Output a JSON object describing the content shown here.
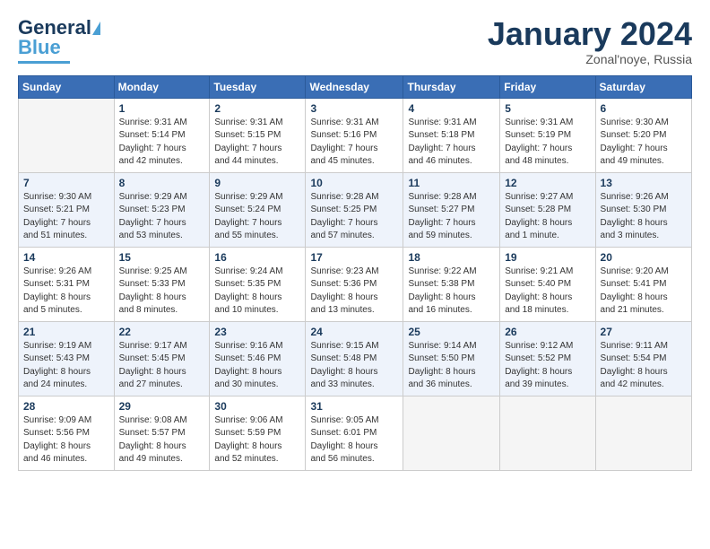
{
  "header": {
    "logo_line1": "General",
    "logo_line2": "Blue",
    "month": "January 2024",
    "location": "Zonal'noye, Russia"
  },
  "days_of_week": [
    "Sunday",
    "Monday",
    "Tuesday",
    "Wednesday",
    "Thursday",
    "Friday",
    "Saturday"
  ],
  "weeks": [
    [
      {
        "day": "",
        "info": ""
      },
      {
        "day": "1",
        "info": "Sunrise: 9:31 AM\nSunset: 5:14 PM\nDaylight: 7 hours\nand 42 minutes."
      },
      {
        "day": "2",
        "info": "Sunrise: 9:31 AM\nSunset: 5:15 PM\nDaylight: 7 hours\nand 44 minutes."
      },
      {
        "day": "3",
        "info": "Sunrise: 9:31 AM\nSunset: 5:16 PM\nDaylight: 7 hours\nand 45 minutes."
      },
      {
        "day": "4",
        "info": "Sunrise: 9:31 AM\nSunset: 5:18 PM\nDaylight: 7 hours\nand 46 minutes."
      },
      {
        "day": "5",
        "info": "Sunrise: 9:31 AM\nSunset: 5:19 PM\nDaylight: 7 hours\nand 48 minutes."
      },
      {
        "day": "6",
        "info": "Sunrise: 9:30 AM\nSunset: 5:20 PM\nDaylight: 7 hours\nand 49 minutes."
      }
    ],
    [
      {
        "day": "7",
        "info": "Sunrise: 9:30 AM\nSunset: 5:21 PM\nDaylight: 7 hours\nand 51 minutes."
      },
      {
        "day": "8",
        "info": "Sunrise: 9:29 AM\nSunset: 5:23 PM\nDaylight: 7 hours\nand 53 minutes."
      },
      {
        "day": "9",
        "info": "Sunrise: 9:29 AM\nSunset: 5:24 PM\nDaylight: 7 hours\nand 55 minutes."
      },
      {
        "day": "10",
        "info": "Sunrise: 9:28 AM\nSunset: 5:25 PM\nDaylight: 7 hours\nand 57 minutes."
      },
      {
        "day": "11",
        "info": "Sunrise: 9:28 AM\nSunset: 5:27 PM\nDaylight: 7 hours\nand 59 minutes."
      },
      {
        "day": "12",
        "info": "Sunrise: 9:27 AM\nSunset: 5:28 PM\nDaylight: 8 hours\nand 1 minute."
      },
      {
        "day": "13",
        "info": "Sunrise: 9:26 AM\nSunset: 5:30 PM\nDaylight: 8 hours\nand 3 minutes."
      }
    ],
    [
      {
        "day": "14",
        "info": "Sunrise: 9:26 AM\nSunset: 5:31 PM\nDaylight: 8 hours\nand 5 minutes."
      },
      {
        "day": "15",
        "info": "Sunrise: 9:25 AM\nSunset: 5:33 PM\nDaylight: 8 hours\nand 8 minutes."
      },
      {
        "day": "16",
        "info": "Sunrise: 9:24 AM\nSunset: 5:35 PM\nDaylight: 8 hours\nand 10 minutes."
      },
      {
        "day": "17",
        "info": "Sunrise: 9:23 AM\nSunset: 5:36 PM\nDaylight: 8 hours\nand 13 minutes."
      },
      {
        "day": "18",
        "info": "Sunrise: 9:22 AM\nSunset: 5:38 PM\nDaylight: 8 hours\nand 16 minutes."
      },
      {
        "day": "19",
        "info": "Sunrise: 9:21 AM\nSunset: 5:40 PM\nDaylight: 8 hours\nand 18 minutes."
      },
      {
        "day": "20",
        "info": "Sunrise: 9:20 AM\nSunset: 5:41 PM\nDaylight: 8 hours\nand 21 minutes."
      }
    ],
    [
      {
        "day": "21",
        "info": "Sunrise: 9:19 AM\nSunset: 5:43 PM\nDaylight: 8 hours\nand 24 minutes."
      },
      {
        "day": "22",
        "info": "Sunrise: 9:17 AM\nSunset: 5:45 PM\nDaylight: 8 hours\nand 27 minutes."
      },
      {
        "day": "23",
        "info": "Sunrise: 9:16 AM\nSunset: 5:46 PM\nDaylight: 8 hours\nand 30 minutes."
      },
      {
        "day": "24",
        "info": "Sunrise: 9:15 AM\nSunset: 5:48 PM\nDaylight: 8 hours\nand 33 minutes."
      },
      {
        "day": "25",
        "info": "Sunrise: 9:14 AM\nSunset: 5:50 PM\nDaylight: 8 hours\nand 36 minutes."
      },
      {
        "day": "26",
        "info": "Sunrise: 9:12 AM\nSunset: 5:52 PM\nDaylight: 8 hours\nand 39 minutes."
      },
      {
        "day": "27",
        "info": "Sunrise: 9:11 AM\nSunset: 5:54 PM\nDaylight: 8 hours\nand 42 minutes."
      }
    ],
    [
      {
        "day": "28",
        "info": "Sunrise: 9:09 AM\nSunset: 5:56 PM\nDaylight: 8 hours\nand 46 minutes."
      },
      {
        "day": "29",
        "info": "Sunrise: 9:08 AM\nSunset: 5:57 PM\nDaylight: 8 hours\nand 49 minutes."
      },
      {
        "day": "30",
        "info": "Sunrise: 9:06 AM\nSunset: 5:59 PM\nDaylight: 8 hours\nand 52 minutes."
      },
      {
        "day": "31",
        "info": "Sunrise: 9:05 AM\nSunset: 6:01 PM\nDaylight: 8 hours\nand 56 minutes."
      },
      {
        "day": "",
        "info": ""
      },
      {
        "day": "",
        "info": ""
      },
      {
        "day": "",
        "info": ""
      }
    ]
  ]
}
